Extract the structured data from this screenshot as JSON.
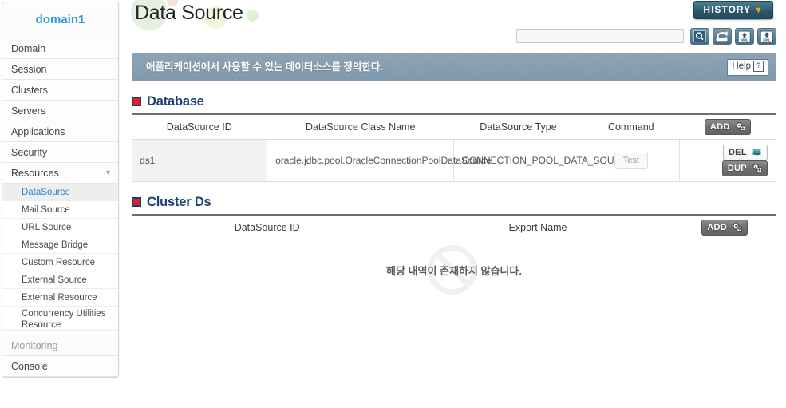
{
  "sidebar": {
    "domain_label": "domain1",
    "items": [
      {
        "label": "Domain",
        "type": "nav"
      },
      {
        "label": "Session",
        "type": "nav"
      },
      {
        "label": "Clusters",
        "type": "nav"
      },
      {
        "label": "Servers",
        "type": "nav"
      },
      {
        "label": "Applications",
        "type": "nav"
      },
      {
        "label": "Security",
        "type": "nav"
      },
      {
        "label": "Resources",
        "type": "nav-expanded",
        "icon": "chevron-down-icon"
      }
    ],
    "sub_items": [
      {
        "label": "DataSource",
        "active": true
      },
      {
        "label": "Mail Source",
        "active": false
      },
      {
        "label": "URL Source",
        "active": false
      },
      {
        "label": "Message Bridge",
        "active": false
      },
      {
        "label": "Custom Resource",
        "active": false
      },
      {
        "label": "External Source",
        "active": false
      },
      {
        "label": "External Resource",
        "active": false
      },
      {
        "label": "Concurrency Utilities Resource",
        "active": false
      }
    ],
    "footer_items": [
      {
        "label": "Monitoring"
      },
      {
        "label": "Console"
      }
    ]
  },
  "header": {
    "title": "Data Source",
    "history_label": "HISTORY",
    "history_chevron": "▼"
  },
  "toolbar": {
    "search_value": "",
    "search_placeholder": "",
    "icons": [
      {
        "name": "search-icon"
      },
      {
        "name": "refresh-icon"
      },
      {
        "name": "xml-upload-icon",
        "label": "XML"
      },
      {
        "name": "xml-download-icon",
        "label": "XML"
      }
    ]
  },
  "notice": {
    "text": "애플리케이션에서 사용할 수 있는 데이터소스를 정의한다.",
    "help_label": "Help",
    "help_icon_char": "?"
  },
  "database_section": {
    "title": "Database",
    "columns": [
      "DataSource ID",
      "DataSource Class Name",
      "DataSource Type",
      "Command"
    ],
    "add_label": "ADD",
    "rows": [
      {
        "datasource_id": "ds1",
        "class_name": "oracle.jdbc.pool.OracleConnectionPoolDataSource",
        "datasource_type": "CONNECTION_POOL_DATA_SOURCE",
        "command_label": "Test",
        "del_label": "DEL",
        "dup_label": "DUP"
      }
    ]
  },
  "cluster_section": {
    "title": "Cluster Ds",
    "columns": [
      "DataSource ID",
      "Export Name"
    ],
    "add_label": "ADD",
    "empty_text": "해당 내역이 존재하지 않습니다."
  },
  "colors": {
    "brand_blue": "#2f9ad6",
    "section_navy": "#1d3f6e",
    "section_red": "#e02027",
    "notice_bar": "#8ba2b5",
    "history_teal": "#326075",
    "history_chevron_orange": "#f0a21c"
  }
}
